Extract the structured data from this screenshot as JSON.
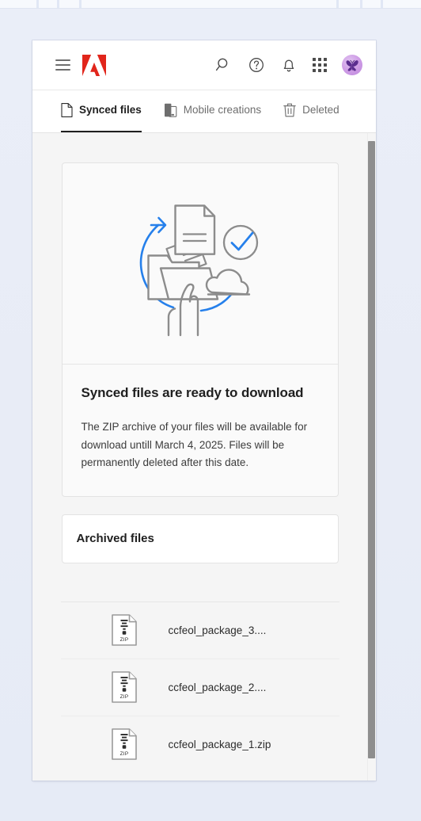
{
  "appbar": {
    "menu_label": "Menu",
    "brand": "Adobe",
    "brand_color": "#E1251B",
    "icons": [
      {
        "name": "search-icon",
        "label": "Search"
      },
      {
        "name": "help-icon",
        "label": "Help"
      },
      {
        "name": "bell-icon",
        "label": "Notifications"
      },
      {
        "name": "app-grid-icon",
        "label": "Apps"
      }
    ],
    "avatar_label": "Account"
  },
  "tabs": [
    {
      "label": "Synced files",
      "icon": "document-icon",
      "active": true
    },
    {
      "label": "Mobile creations",
      "icon": "mobile-icon",
      "active": false
    },
    {
      "label": "Deleted",
      "icon": "trash-icon",
      "active": false
    }
  ],
  "hero": {
    "illustration": "sync-download-illustration",
    "accent_color": "#2680EB",
    "line_color": "#8C8C8C",
    "title": "Synced files are ready to download",
    "description": "The ZIP archive of your files will be available for download untill March 4, 2025. Files will be permanently deleted after this date."
  },
  "archived": {
    "title": "Archived files"
  },
  "files": [
    {
      "name": "ccfeol_package_3....",
      "type": "ZIP",
      "icon": "zip-file-icon"
    },
    {
      "name": "ccfeol_package_2....",
      "type": "ZIP",
      "icon": "zip-file-icon"
    },
    {
      "name": "ccfeol_package_1.zip",
      "type": "ZIP",
      "icon": "zip-file-icon"
    }
  ],
  "scrollbar": {
    "orientation": "vertical"
  }
}
